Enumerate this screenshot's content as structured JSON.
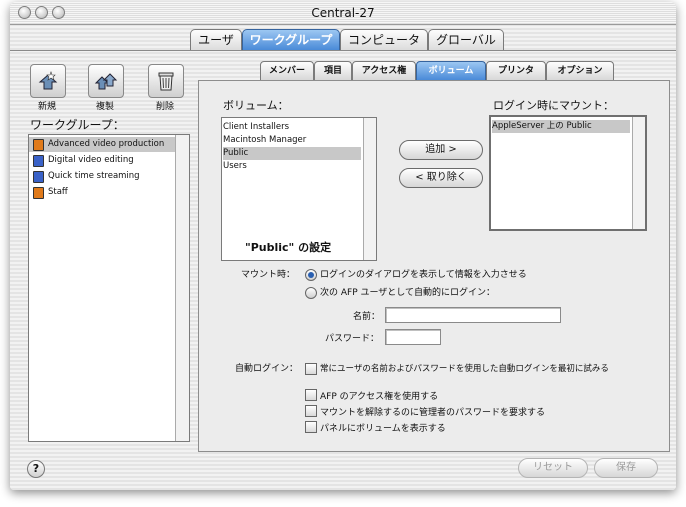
{
  "window": {
    "title": "Central-27"
  },
  "top_tabs": [
    {
      "label": "ユーザ"
    },
    {
      "label": "ワークグループ",
      "active": true
    },
    {
      "label": "コンピュータ"
    },
    {
      "label": "グローバル"
    }
  ],
  "toolbar": {
    "new_label": "新規",
    "duplicate_label": "複製",
    "delete_label": "削除"
  },
  "sidebar": {
    "title": "ワークグループ：",
    "items": [
      {
        "label": "Advanced video production",
        "selected": true,
        "icon": "workgroup-icon",
        "color": "#e07a1a"
      },
      {
        "label": "Digital video editing",
        "icon": "workgroup-icon",
        "color": "#3a62c8"
      },
      {
        "label": "Quick time streaming",
        "icon": "workgroup-icon",
        "color": "#3a62c8"
      },
      {
        "label": "Staff",
        "icon": "workgroup-icon",
        "color": "#e07a1a"
      }
    ]
  },
  "sub_tabs": [
    {
      "label": "メンバー"
    },
    {
      "label": "項目"
    },
    {
      "label": "アクセス権"
    },
    {
      "label": "ボリューム",
      "active": true
    },
    {
      "label": "プリンタ"
    },
    {
      "label": "オプション"
    }
  ],
  "volumes": {
    "title": "ボリューム：",
    "items": [
      {
        "label": "Client Installers"
      },
      {
        "label": "Macintosh Manager"
      },
      {
        "label": "Public",
        "selected": true
      },
      {
        "label": "Users"
      }
    ]
  },
  "mount_list": {
    "title": "ログイン時にマウント：",
    "items": [
      {
        "label": "AppleServer 上の Public",
        "selected": true
      }
    ]
  },
  "buttons": {
    "add": "追加 >",
    "remove": "< 取り除く",
    "revert": "リセット",
    "save": "保存"
  },
  "settings": {
    "title": "\"Public\" の設定",
    "mount_label": "マウント時：",
    "radio_dialog": "ログインのダイアログを表示して情報を入力させる",
    "radio_auto": "次の AFP ユーザとして自動的にログイン：",
    "name_label": "名前：",
    "name_value": "",
    "password_label": "パスワード：",
    "password_value": "",
    "autologin_label": "自動ログイン：",
    "chk_autologin": "常にユーザの名前およびパスワードを使用した自動ログインを最初に試みる",
    "chk_afp": "AFP のアクセス権を使用する",
    "chk_admin_pw": "マウントを解除するのに管理者のパスワードを要求する",
    "chk_show_panel": "パネルにボリュームを表示する"
  },
  "help_symbol": "?",
  "colors": {
    "accent": "#4a8ad8",
    "selection": "#c8c8c8"
  }
}
